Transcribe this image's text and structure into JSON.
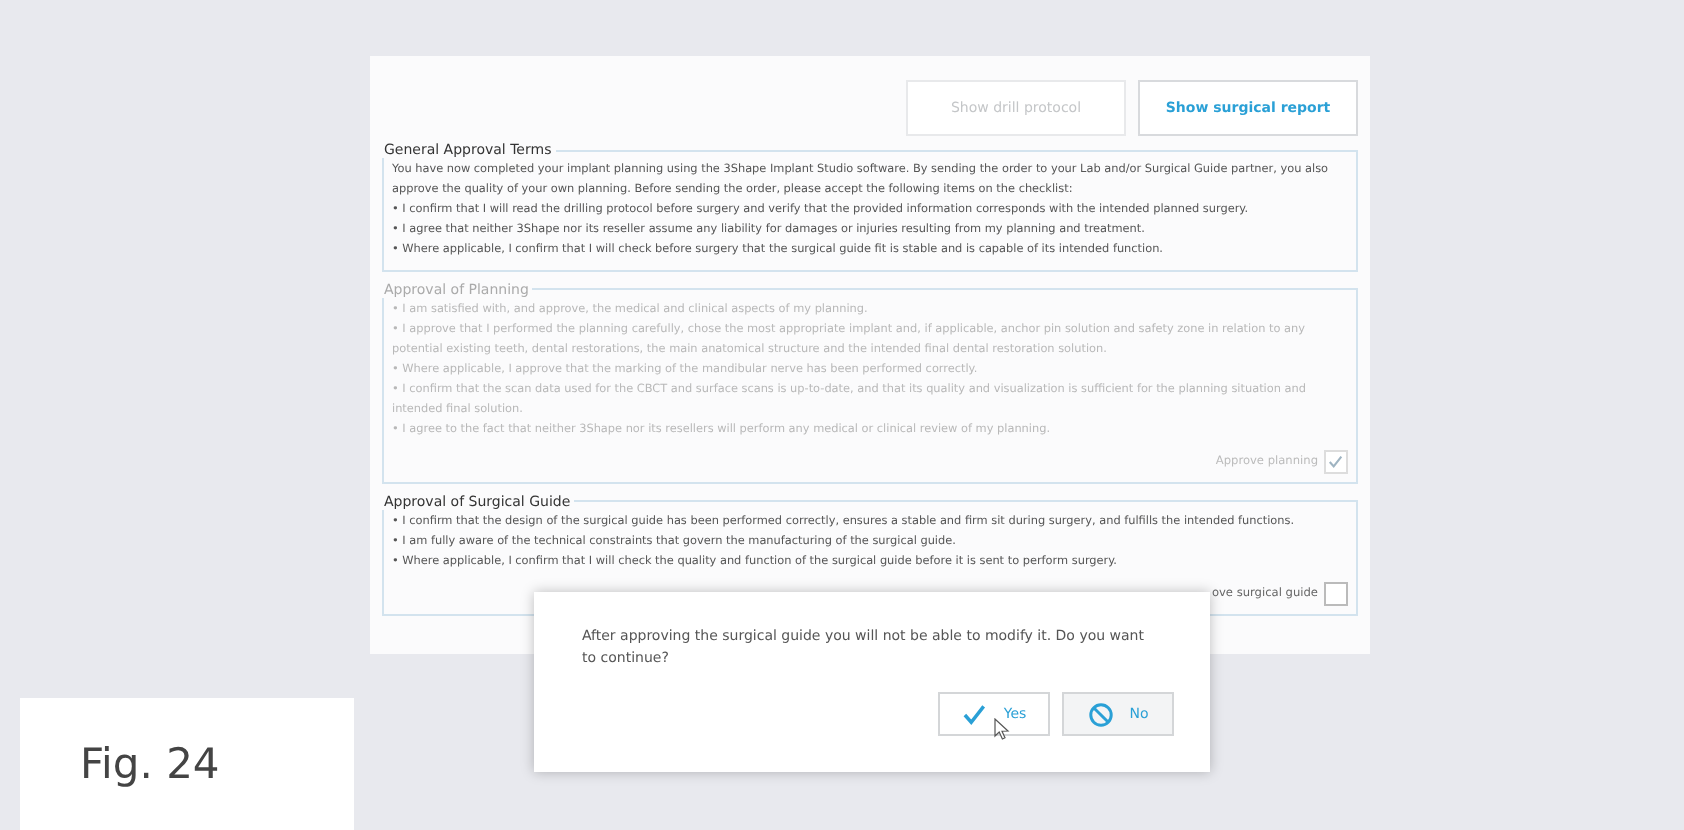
{
  "buttons": [
    {
      "label": "Show drill protocol",
      "disabled": true
    },
    {
      "label": "Show surgical report",
      "disabled": false
    }
  ],
  "sections": [
    {
      "title": "General Approval Terms",
      "disabled": false,
      "lines": [
        "You have now completed your implant planning using the 3Shape Implant Studio software. By sending the order to your Lab and/or Surgical Guide partner, you also approve the quality of your own planning. Before sending the order, please accept the following items on the checklist:",
        "• I confirm that I will read the drilling protocol before surgery and verify that the provided information corresponds with the intended planned surgery.",
        "• I agree that neither 3Shape nor its reseller assume any liability for damages or injuries resulting from my planning and treatment.",
        "• Where applicable, I confirm that I will check before surgery that the surgical guide fit is stable and is capable of its intended function."
      ]
    },
    {
      "title": "Approval of Planning",
      "disabled": true,
      "lines": [
        "• I am satisfied with, and approve, the medical and clinical aspects of my planning.",
        "• I approve that I performed the planning carefully, chose the most appropriate implant and, if applicable, anchor pin solution and safety zone in relation to any potential existing teeth, dental restorations, the main anatomical structure and the intended final dental restoration solution.",
        "• Where applicable, I approve that the marking of the mandibular nerve has been performed correctly.",
        "• I confirm that the scan data used for the CBCT and surface scans is up-to-date, and that its quality and visualization is sufficient for the planning situation and intended final solution.",
        "• I agree to the fact that neither 3Shape nor its resellers will perform any medical or clinical review of my planning."
      ],
      "approval": {
        "label": "Approve planning",
        "checked": true
      }
    },
    {
      "title": "Approval of Surgical Guide",
      "disabled": false,
      "lines": [
        "• I confirm that the design of the surgical guide has been performed correctly, ensures a stable and firm sit during surgery, and fulfills the intended functions.",
        "• I am fully aware of the technical constraints that govern the manufacturing of the surgical guide.",
        "• Where applicable, I confirm that I will check the quality and function of the surgical guide before it is sent to perform surgery."
      ],
      "approval": {
        "label": "ove surgical guide",
        "checked": false
      }
    }
  ],
  "dialog": {
    "message": "After approving the surgical guide you will not be able to modify it. Do you want to continue?",
    "buttons": [
      {
        "kind": "confirm",
        "label": "Yes"
      },
      {
        "kind": "cancel",
        "label": "No"
      }
    ]
  },
  "caption": "Fig. 24"
}
